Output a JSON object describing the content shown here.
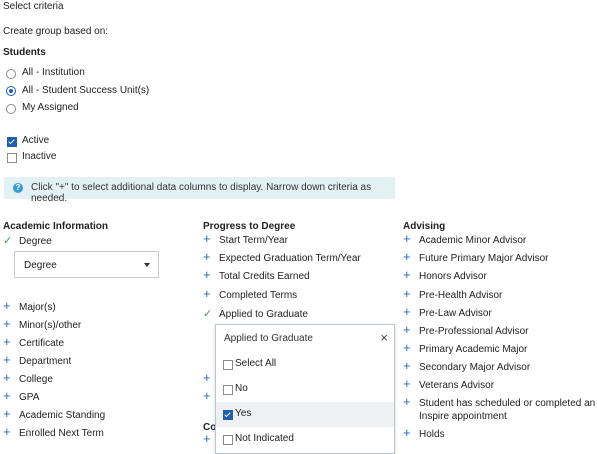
{
  "header": {
    "title": "Select criteria",
    "subtitle": "Create group based on:"
  },
  "students": {
    "label": "Students",
    "options": [
      {
        "label": "All - Institution",
        "selected": false
      },
      {
        "label": "All - Student Success Unit(s)",
        "selected": true
      },
      {
        "label": "My Assigned",
        "selected": false
      }
    ]
  },
  "status": [
    {
      "label": "Active",
      "checked": true
    },
    {
      "label": "Inactive",
      "checked": false
    }
  ],
  "info": {
    "icon": "question-icon",
    "text": "Click \"+\" to select additional data columns to display. Narrow down criteria as needed."
  },
  "academic": {
    "title": "Academic Information",
    "degree_label": "Degree",
    "degree_select_value": "Degree",
    "items": [
      "Major(s)",
      "Minor(s)/other",
      "Certificate",
      "Department",
      "College",
      "GPA",
      "Academic Standing",
      "Enrolled Next Term"
    ]
  },
  "progress": {
    "title": "Progress to Degree",
    "items": [
      "Start Term/Year",
      "Expected Graduation Term/Year",
      "Total Credits Earned",
      "Completed Terms"
    ],
    "checked_item": "Applied to Graduate",
    "partial_heading": "Co"
  },
  "dropdown": {
    "title": "Applied to Graduate",
    "options": [
      {
        "label": "Select All",
        "checked": false
      },
      {
        "label": "No",
        "checked": false
      },
      {
        "label": "Yes",
        "checked": true
      },
      {
        "label": "Not Indicated",
        "checked": false
      }
    ]
  },
  "advising": {
    "title": "Advising",
    "items": [
      "Academic Minor Advisor",
      "Future Primary Major Advisor",
      "Honors Advisor",
      "Pre-Health Advisor",
      "Pre-Law Advisor",
      "Pre-Professional Advisor",
      "Primary Academic Major",
      "Secondary Major Advisor",
      "Veterans Advisor",
      "Student has scheduled or completed an",
      "Inspire appointment",
      "Holds"
    ]
  },
  "colors": {
    "accent": "#2a6db5",
    "check": "#3a9a4a",
    "info_bg": "#e3f1f4"
  }
}
